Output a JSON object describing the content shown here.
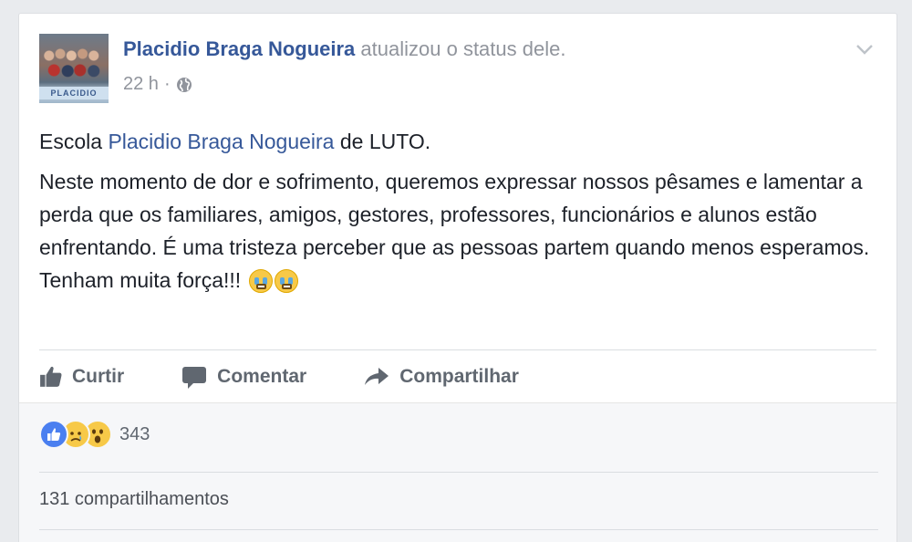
{
  "post": {
    "author": "Placidio Braga Nogueira",
    "action_text": "atualizou o status dele.",
    "time": "22 h",
    "separator": "·",
    "privacy_icon": "globe-icon",
    "menu_icon": "chevron-down-icon",
    "avatar_banner": "PLACIDIO"
  },
  "content": {
    "line1_prefix": "Escola ",
    "line1_mention": "Placidio Braga Nogueira",
    "line1_suffix": " de LUTO.",
    "paragraph": "Neste momento de dor e sofrimento, queremos expressar nossos pêsames e lamentar a perda que os familiares, amigos, gestores, professores, funcionários e alunos estão enfrentando. É uma tristeza perceber que as pessoas partem quando menos esperamos.",
    "closing": "Tenham muita força!!!",
    "closing_emoji": "crying-face-emoji"
  },
  "actions": {
    "like_label": "Curtir",
    "comment_label": "Comentar",
    "share_label": "Compartilhar"
  },
  "stats": {
    "reaction_icons": [
      "like-reaction-icon",
      "sad-reaction-icon",
      "wow-reaction-icon"
    ],
    "reaction_count": "343",
    "shares_text": "131 compartilhamentos"
  },
  "colors": {
    "link": "#365899",
    "text": "#1d2129",
    "muted": "#90949c",
    "action": "#606770",
    "background": "#e9ebee"
  }
}
